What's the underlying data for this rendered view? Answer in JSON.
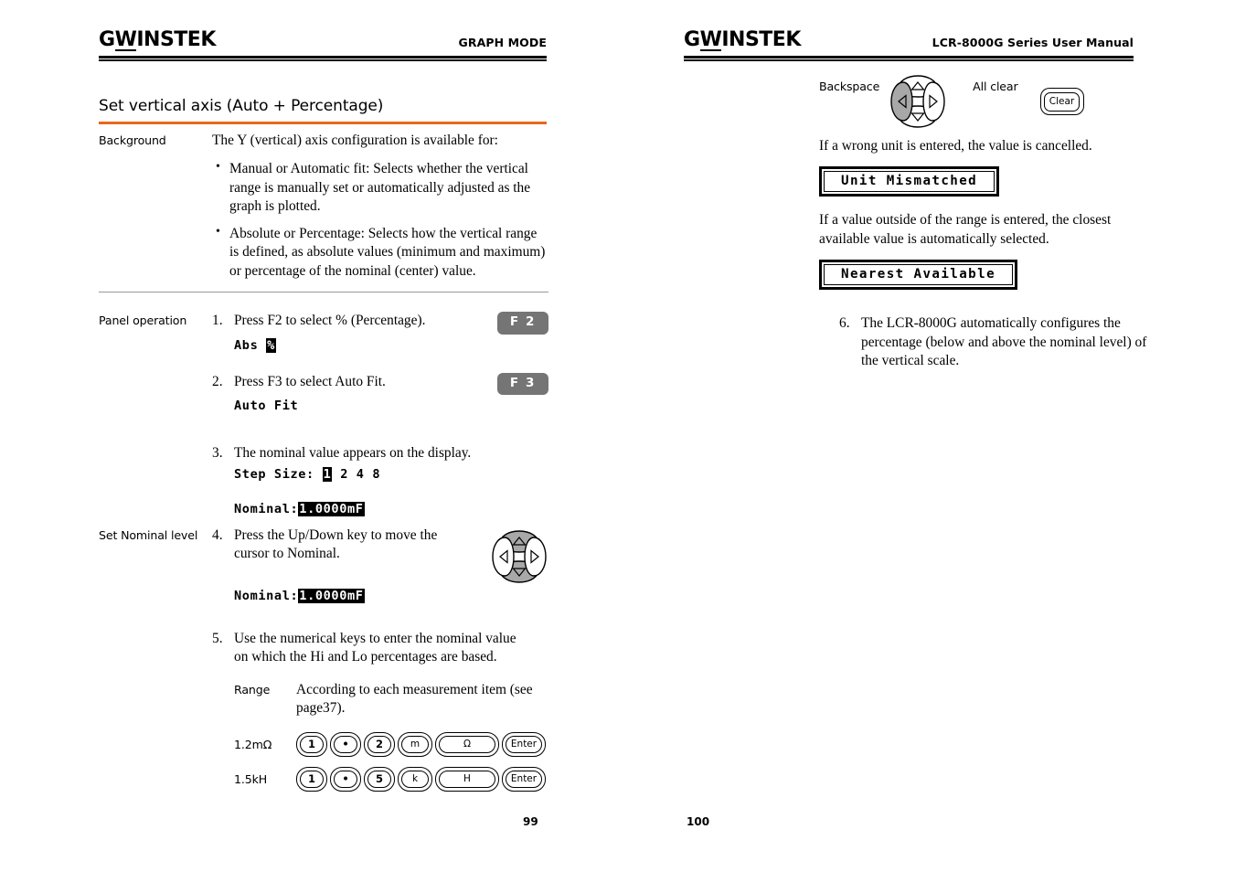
{
  "brand": {
    "logo_g": "G",
    "logo_w": "W",
    "logo_rest": "INSTEK"
  },
  "left_page": {
    "header_title": "GRAPH MODE",
    "page_number": "99",
    "section_title": "Set vertical axis (Auto + Percentage)",
    "background": {
      "label": "Background",
      "intro": "The Y (vertical) axis configuration is available for:",
      "bullets": [
        "Manual or Automatic fit: Selects whether the vertical range is manually set or automatically adjusted as the graph is plotted.",
        "Absolute or Percentage: Selects how the vertical range is defined, as absolute values (minimum and maximum) or percentage of the nominal (center) value."
      ]
    },
    "panel_operation": {
      "label": "Panel operation",
      "step1": {
        "num": "1.",
        "text": "Press F2 to select % (Percentage).",
        "fkey": "F 2",
        "display_normal": "Abs ",
        "display_inverted": "%"
      },
      "step2": {
        "num": "2.",
        "text": "Press F3 to select Auto Fit.",
        "fkey": "F 3",
        "display_normal": "Auto Fit"
      },
      "step3": {
        "num": "3.",
        "text": "The nominal value appears on the display.",
        "step_size_label": "Step Size: ",
        "step_size_selected": "1",
        "step_size_rest": " 2 4 8",
        "nominal_label": "Nominal:",
        "nominal_value": "1.0000mF"
      }
    },
    "set_nominal": {
      "label": "Set Nominal level",
      "step4": {
        "num": "4.",
        "text": "Press the Up/Down key to move the cursor to Nominal.",
        "nominal_label": "Nominal:",
        "nominal_value": "1.0000mF"
      },
      "step5": {
        "num": "5.",
        "text": "Use the numerical keys to enter the nominal value on which the Hi and Lo percentages are based.",
        "range_label": "Range",
        "range_text": "According to each measurement item (see page37).",
        "examples": [
          {
            "label": "1.2mΩ",
            "keys": [
              "1",
              "•",
              "2",
              "m",
              "Ω",
              "Enter"
            ]
          },
          {
            "label": "1.5kH",
            "keys": [
              "1",
              "•",
              "5",
              "k",
              "H",
              "Enter"
            ]
          }
        ]
      }
    }
  },
  "right_page": {
    "header_title": "LCR-8000G Series User Manual",
    "page_number": "100",
    "backspace_label": "Backspace",
    "all_clear_label": "All clear",
    "clear_key_label": "Clear",
    "para1": "If a wrong unit is entered, the value is cancelled.",
    "msg1": "Unit Mismatched",
    "para2": "If a value outside of the range is entered, the closest available value is automatically selected.",
    "msg2": "Nearest Available",
    "step6": {
      "num": "6.",
      "text": "The LCR-8000G automatically configures the percentage (below and above the nominal level) of the vertical scale."
    }
  },
  "colors": {
    "accent_orange": "#E8671C",
    "fkey_gray": "#757575",
    "dpad_gray": "#9a9a9a"
  }
}
